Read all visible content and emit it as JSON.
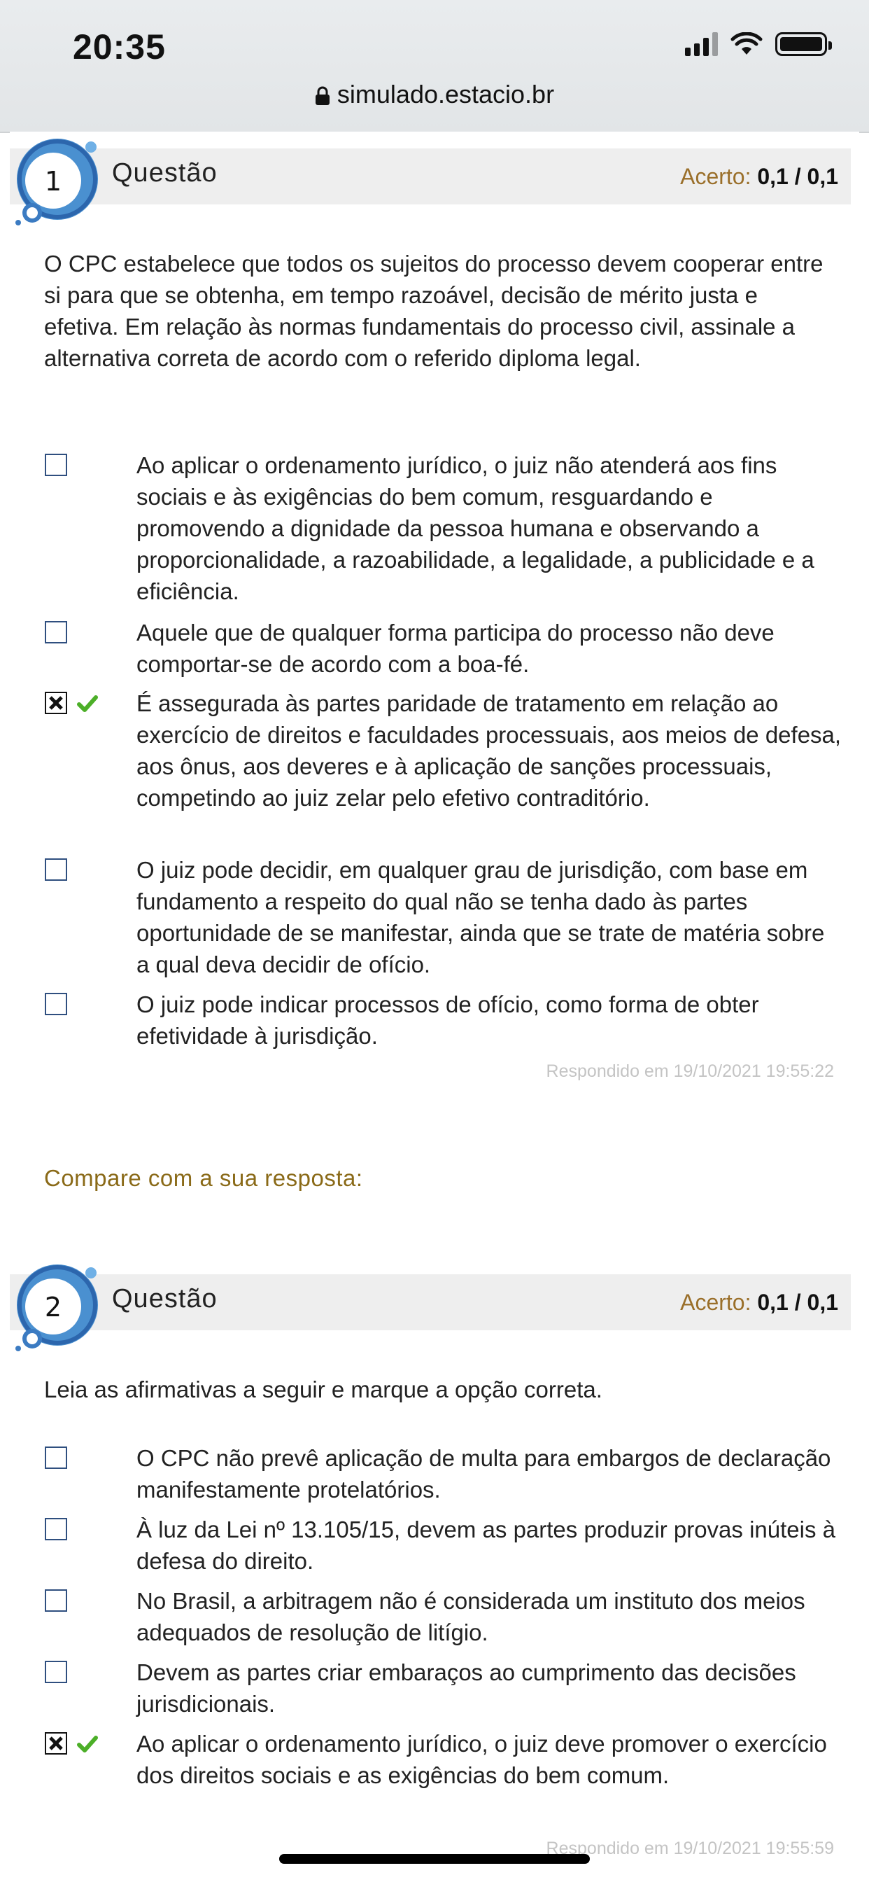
{
  "status_bar": {
    "time": "20:35"
  },
  "browser": {
    "url": "simulado.estacio.br"
  },
  "score_label": "Acerto:",
  "questions": [
    {
      "number": "1",
      "title": "Questão",
      "score_value": "0,1",
      "score_total": "/ 0,1",
      "stem": "O CPC estabelece que todos os sujeitos do processo devem cooperar entre si para que se obtenha, em tempo razoável, decisão de mérito justa e efetiva. Em relação às normas fundamentais do processo civil, assinale a alternativa correta de acordo com o referido diploma legal.",
      "options": [
        {
          "text": "Ao aplicar o ordenamento jurídico, o juiz não atenderá aos fins sociais e às exigências do bem comum, resguardando e promovendo a dignidade da pessoa humana e observando a proporcionalidade, a razoabilidade, a legalidade, a publicidade e a eficiência.",
          "checked": false,
          "correct": false
        },
        {
          "text": "Aquele que de qualquer forma participa do processo não deve comportar-se de acordo com a boa-fé.",
          "checked": false,
          "correct": false
        },
        {
          "text": "É assegurada às partes paridade de tratamento em relação ao exercício de direitos e faculdades processuais, aos meios de defesa, aos ônus, aos deveres e à aplicação de sanções processuais, competindo ao juiz zelar pelo efetivo contraditório.",
          "checked": true,
          "correct": true
        },
        {
          "text": "O juiz pode decidir, em qualquer grau de jurisdição, com base em fundamento a respeito do qual não se tenha dado às partes oportunidade de se manifestar, ainda que se trate de matéria sobre a qual deva decidir de ofício.",
          "checked": false,
          "correct": false
        },
        {
          "text": "O juiz pode indicar processos de ofício, como forma de obter efetividade à jurisdição.",
          "checked": false,
          "correct": false
        }
      ],
      "answered": "Respondido em 19/10/2021 19:55:22",
      "compare": "Compare com a sua resposta:"
    },
    {
      "number": "2",
      "title": "Questão",
      "score_value": "0,1",
      "score_total": "/ 0,1",
      "stem": "Leia as afirmativas a seguir e marque a opção correta.",
      "options": [
        {
          "text": "O CPC não prevê aplicação de multa para embargos de declaração manifestamente protelatórios.",
          "checked": false,
          "correct": false
        },
        {
          "text": "À luz da Lei nº 13.105/15, devem as partes produzir provas inúteis à defesa do direito.",
          "checked": false,
          "correct": false
        },
        {
          "text": "No Brasil, a arbitragem não é considerada um instituto dos meios adequados de resolução de litígio.",
          "checked": false,
          "correct": false
        },
        {
          "text": "Devem as partes criar embaraços ao cumprimento das decisões jurisdicionais.",
          "checked": false,
          "correct": false
        },
        {
          "text": "Ao aplicar o ordenamento jurídico, o juiz deve promover o exercício dos direitos sociais e as exigências do bem comum.",
          "checked": true,
          "correct": true
        }
      ],
      "answered": "Respondido em 19/10/2021 19:55:59"
    }
  ]
}
